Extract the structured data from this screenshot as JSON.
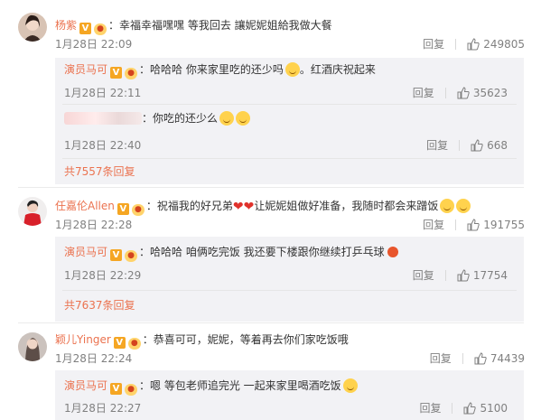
{
  "threads": [
    {
      "user": "杨紫",
      "text": "幸福幸福嘿嘿 等我回去 讓妮妮姐給我做大餐",
      "time": "1月28日 22:09",
      "reply_label": "回复",
      "likes": "249805",
      "replies": [
        {
          "user": "演员马可",
          "text": "哈哈哈 你来家里吃的还少吗",
          "suffix": "。红酒庆祝起来",
          "time": "1月28日 22:11",
          "reply_label": "回复",
          "likes": "35623"
        },
        {
          "user": "",
          "text": "你吃的还少么",
          "time": "1月28日 22:40",
          "reply_label": "回复",
          "likes": "668"
        }
      ],
      "more": "共7557条回复"
    },
    {
      "user": "任嘉伦Allen",
      "text": "祝福我的好兄弟",
      "suffix": "让妮妮姐做好准备，我随时都会来蹭饭",
      "time": "1月28日 22:28",
      "reply_label": "回复",
      "likes": "191755",
      "replies": [
        {
          "user": "演员马可",
          "text": "哈哈哈 咱俩吃完饭 我还要下楼跟你继续打乒乓球",
          "time": "1月28日 22:29",
          "reply_label": "回复",
          "likes": "17754"
        }
      ],
      "more": "共7637条回复"
    },
    {
      "user": "颖儿Yinger",
      "text": "恭喜可可，妮妮，等着再去你们家吃饭哦",
      "time": "1月28日 22:24",
      "reply_label": "回复",
      "likes": "74439",
      "replies": [
        {
          "user": "演员马可",
          "text": "嗯 等包老师追完光 一起来家里喝酒吃饭",
          "time": "1月28日 22:27",
          "reply_label": "回复",
          "likes": "5100"
        }
      ]
    }
  ],
  "colors": {
    "username": "#eb7350",
    "reply_bg": "#f2f2f5",
    "meta": "#808080"
  }
}
